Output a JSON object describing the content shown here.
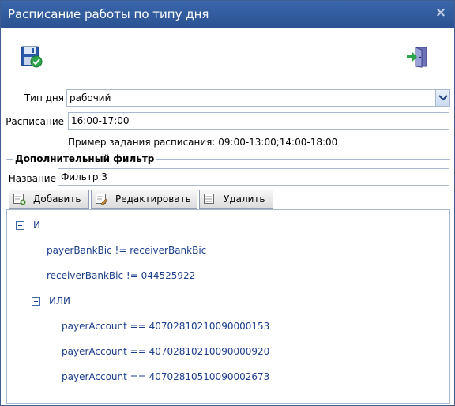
{
  "window": {
    "title": "Расписание работы по типу дня",
    "close_label": "×"
  },
  "toolbar": {
    "save_icon": "save-check-icon",
    "exit_icon": "exit-door-icon"
  },
  "form": {
    "day_type_label": "Тип дня",
    "day_type_value": "рабочий",
    "schedule_label": "Расписание",
    "schedule_value": "16:00-17:00",
    "schedule_hint": "Пример задания расписания: 09:00-13:00;14:00-18:00"
  },
  "filter": {
    "section_title": "Дополнительный фильтр",
    "name_label": "Название",
    "name_value": "Фильтр 3",
    "buttons": {
      "add": "Добавить",
      "edit": "Редактировать",
      "delete": "Удалить"
    },
    "tree": {
      "root": "И",
      "root_children": [
        "payerBankBic != receiverBankBic",
        "receiverBankBic != 044525922"
      ],
      "or_node": "ИЛИ",
      "or_children": [
        "payerAccount == 40702810210090000153",
        "payerAccount == 40702810210090000920",
        "payerAccount == 40702810510090002673"
      ]
    }
  },
  "colors": {
    "titlebar": "#2e5a9c",
    "tree_text": "#1b3e8c",
    "border": "#a9b8cc"
  }
}
